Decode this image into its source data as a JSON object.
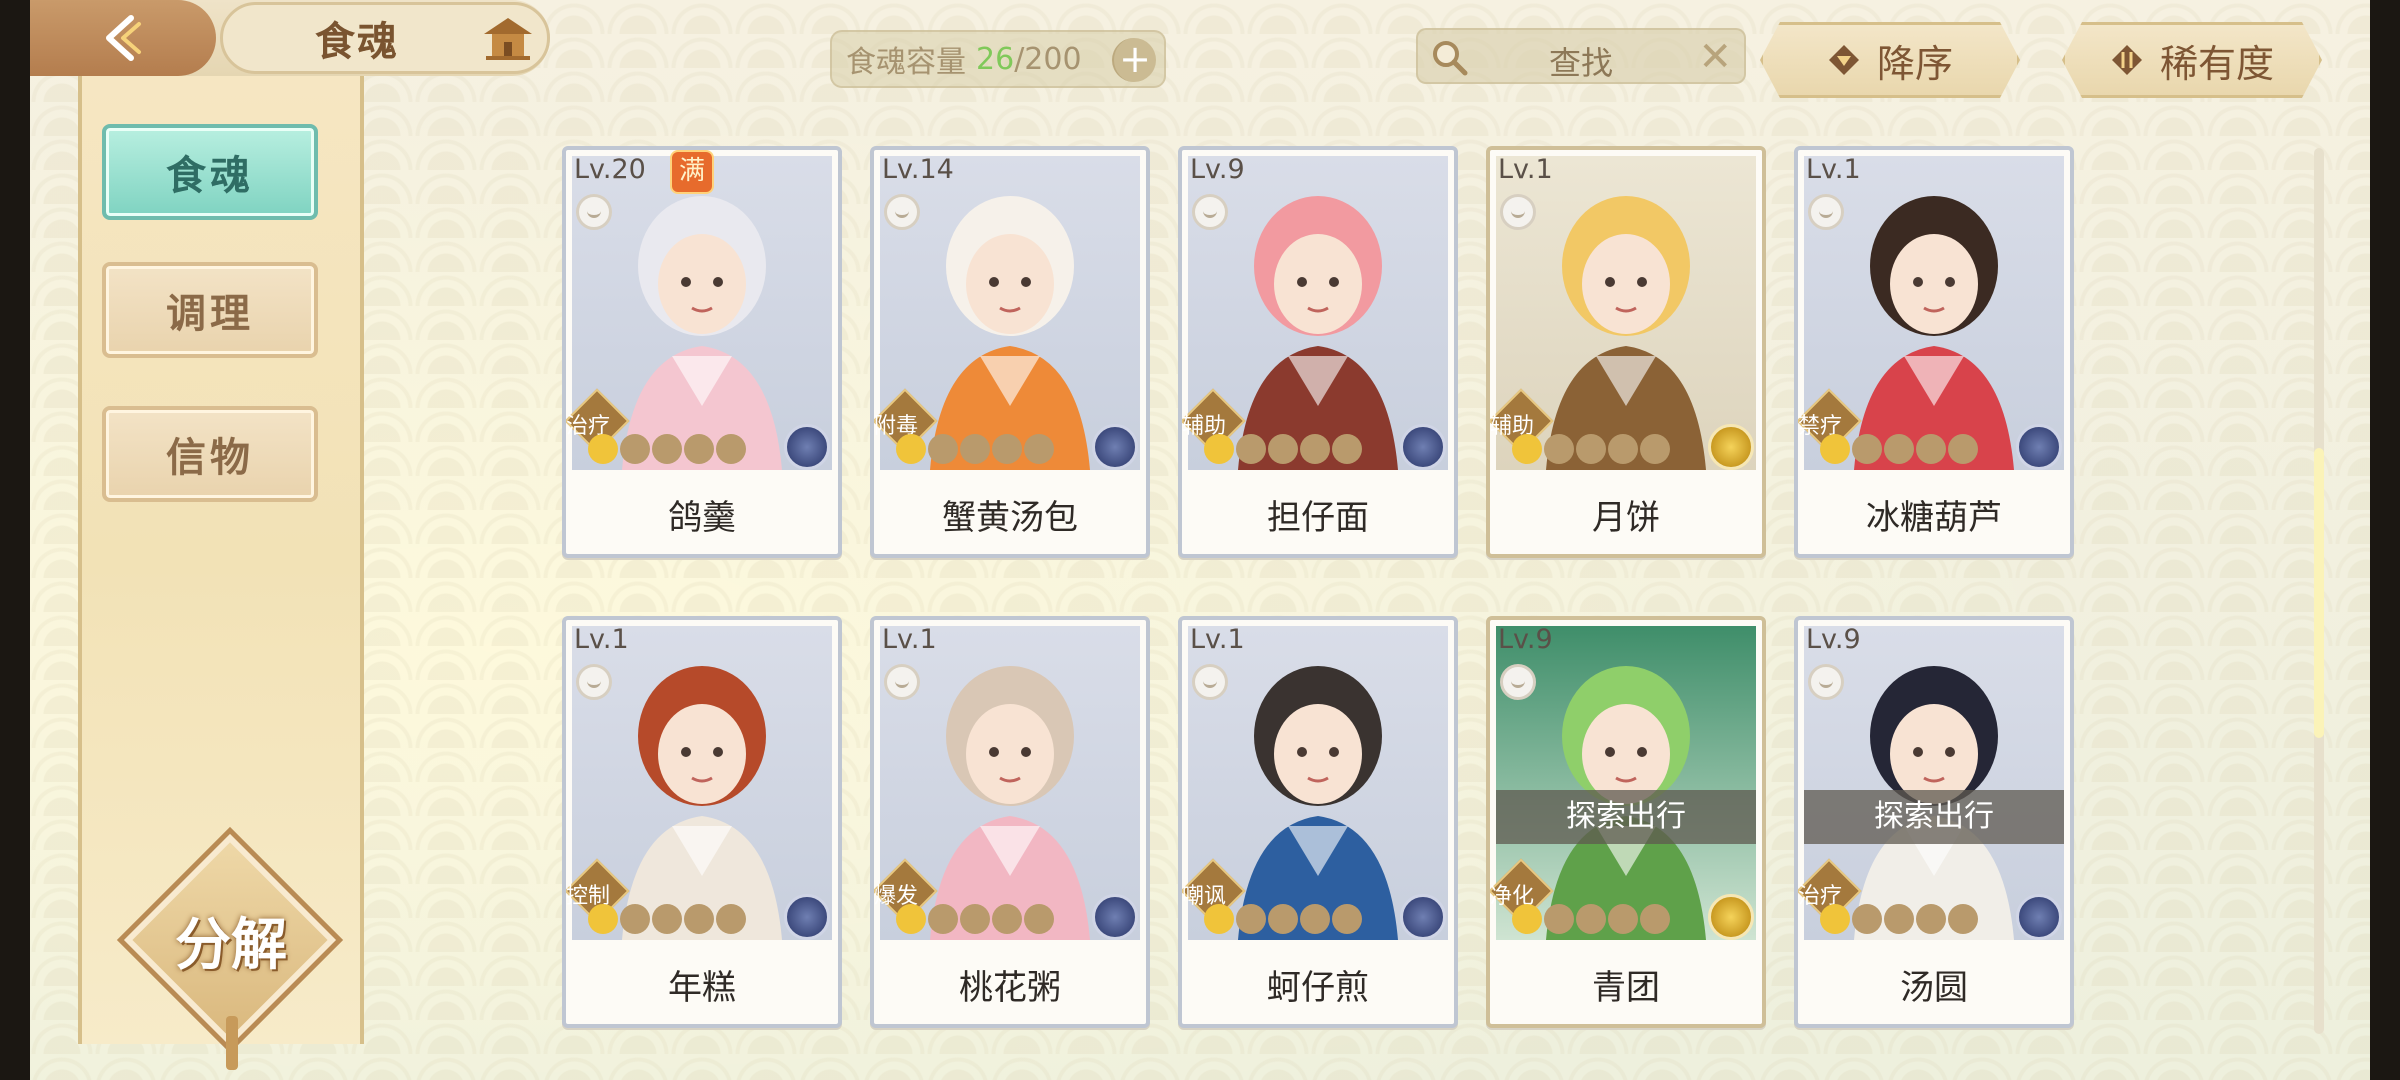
{
  "header": {
    "title": "食魂",
    "capacity_label": "食魂容量",
    "capacity_current": "26",
    "capacity_sep": "/",
    "capacity_max": "200",
    "capacity_plus": "+",
    "search_text": "查找",
    "search_clear": "✕",
    "sort_order_label": "降序",
    "sort_rarity_label": "稀有度"
  },
  "sidebar": {
    "items": [
      {
        "label": "食魂",
        "active": true
      },
      {
        "label": "调理",
        "active": false
      },
      {
        "label": "信物",
        "active": false
      }
    ],
    "decompose_label": "分解"
  },
  "cards": [
    {
      "level": "Lv.20",
      "full_badge": "满",
      "role": "治疗",
      "stars_on": 1,
      "name": "鸽羹",
      "rarity": "sapphire",
      "status": ""
    },
    {
      "level": "Lv.14",
      "full_badge": "",
      "role": "附毒",
      "stars_on": 1,
      "name": "蟹黄汤包",
      "rarity": "sapphire",
      "status": ""
    },
    {
      "level": "Lv.9",
      "full_badge": "",
      "role": "辅助",
      "stars_on": 1,
      "name": "担仔面",
      "rarity": "sapphire",
      "status": ""
    },
    {
      "level": "Lv.1",
      "full_badge": "",
      "role": "辅助",
      "stars_on": 1,
      "name": "月饼",
      "rarity": "gold",
      "status": ""
    },
    {
      "level": "Lv.1",
      "full_badge": "",
      "role": "禁疗",
      "stars_on": 1,
      "name": "冰糖葫芦",
      "rarity": "sapphire",
      "status": ""
    },
    {
      "level": "Lv.1",
      "full_badge": "",
      "role": "控制",
      "stars_on": 1,
      "name": "年糕",
      "rarity": "sapphire",
      "status": ""
    },
    {
      "level": "Lv.1",
      "full_badge": "",
      "role": "爆发",
      "stars_on": 1,
      "name": "桃花粥",
      "rarity": "sapphire",
      "status": ""
    },
    {
      "level": "Lv.1",
      "full_badge": "",
      "role": "嘲讽",
      "stars_on": 1,
      "name": "蚵仔煎",
      "rarity": "sapphire",
      "status": ""
    },
    {
      "level": "Lv.9",
      "full_badge": "",
      "role": "净化",
      "stars_on": 1,
      "name": "青团",
      "rarity": "gold",
      "status": "探索出行"
    },
    {
      "level": "Lv.9",
      "full_badge": "",
      "role": "治疗",
      "stars_on": 1,
      "name": "汤圆",
      "rarity": "sapphire",
      "status": "探索出行"
    }
  ],
  "colors": {
    "accent_teal": "#7fd3c1",
    "capacity_current": "#80c95a",
    "brown_text": "#7e5634"
  }
}
